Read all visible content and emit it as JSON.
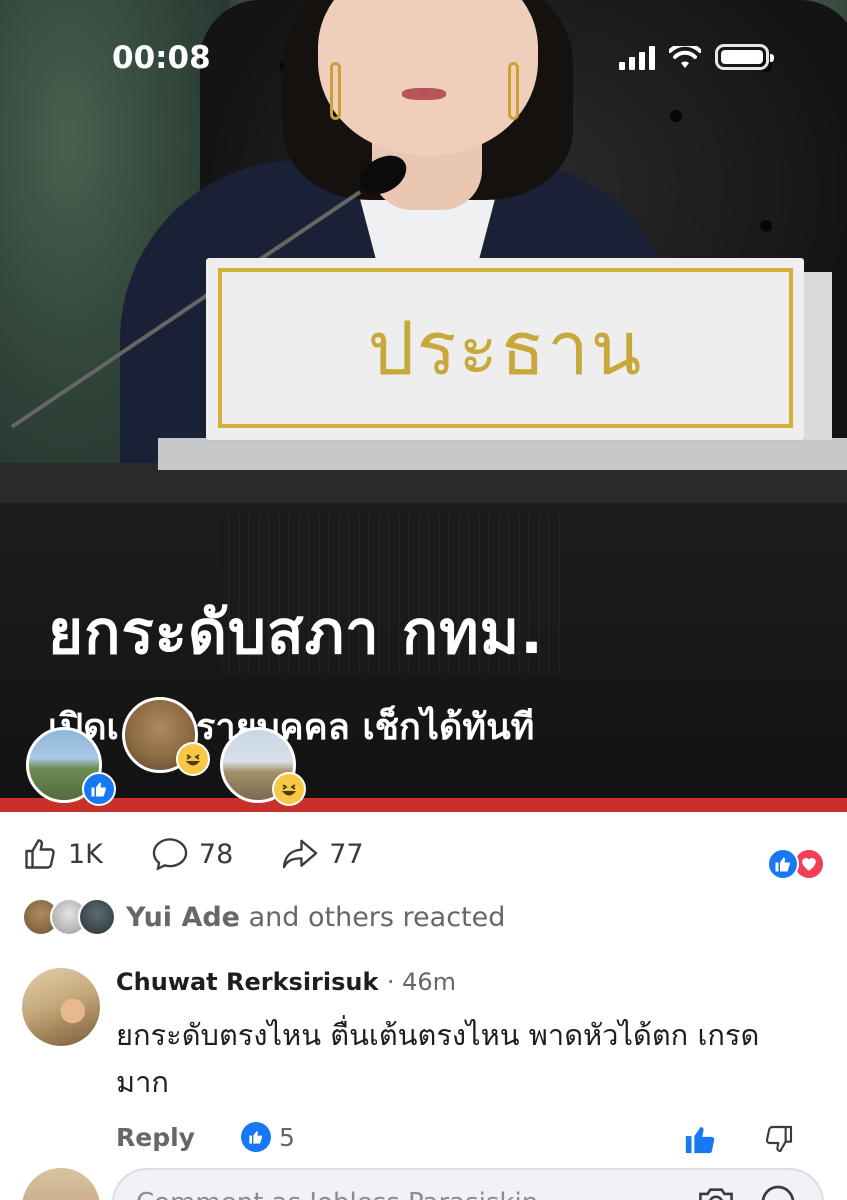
{
  "status_bar": {
    "time": "00:08"
  },
  "post_image": {
    "plaque_text": "ประธาน",
    "headline": "ยกระดับสภา กทม.",
    "subline": "เปิดเ      งมติรายบุคคล เช็กได้ทันที"
  },
  "post_stats": {
    "likes": "1K",
    "comments": "78",
    "shares": "77",
    "reaction_icons": [
      "like-icon",
      "love-icon"
    ]
  },
  "reacted": {
    "name": "Yui Ade",
    "suffix": "and others reacted"
  },
  "comment": {
    "author": "Chuwat Rerksirisuk",
    "time": "· 46m",
    "text": "ยกระดับตรงไหน ตื่นเต้นตรงไหน พาดหัวได้ตก เกรดมาก",
    "reply_label": "Reply",
    "like_count": "5"
  },
  "composer": {
    "placeholder": "Comment as Jobless Parasiskin"
  },
  "colors": {
    "facebook_blue": "#1877f2",
    "love_red": "#f33e58",
    "haha_yellow": "#f7c843",
    "banner_red": "#c8302c",
    "plaque_gold": "#c8a73b"
  }
}
